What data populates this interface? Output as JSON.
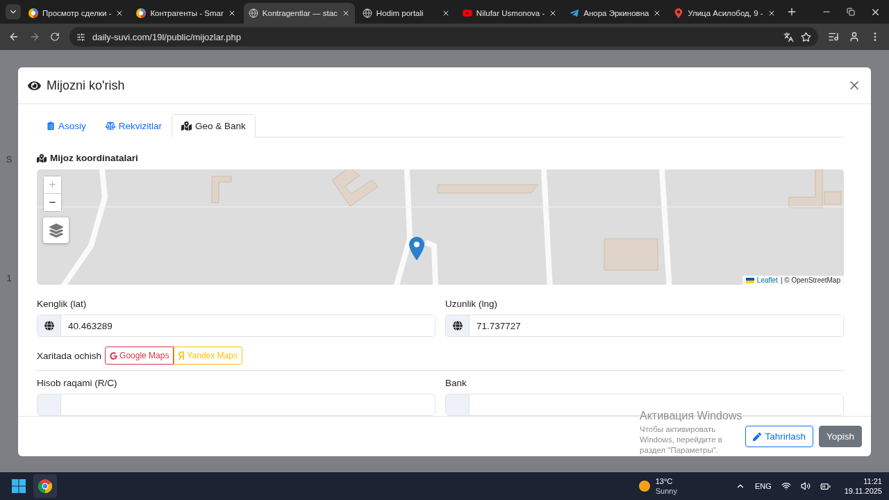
{
  "browser": {
    "tabs": [
      {
        "title": "Просмотр сделки -",
        "kind": "colorwheel",
        "selected": false
      },
      {
        "title": "Контрагенты - Smar",
        "kind": "colorwheel",
        "selected": false
      },
      {
        "title": "Kontragentlar — stac",
        "kind": "globe",
        "selected": true
      },
      {
        "title": "Hodim portali",
        "kind": "globe",
        "selected": false
      },
      {
        "title": "Nilufar Usmonova -",
        "kind": "youtube",
        "selected": false
      },
      {
        "title": "Анора Эркиновна",
        "kind": "telegram",
        "selected": false
      },
      {
        "title": "Улица Асилобод, 9 -",
        "kind": "pin",
        "selected": false
      }
    ],
    "address": "daily-suvi.com/19l/public/mijozlar.php"
  },
  "background_page": {
    "letters": [
      "S",
      "1"
    ]
  },
  "modal": {
    "title": "Mijozni ko'rish",
    "tabs": [
      {
        "label": "Asosiy",
        "selected": false
      },
      {
        "label": "Rekvizitlar",
        "selected": false
      },
      {
        "label": "Geo & Bank",
        "selected": true
      }
    ],
    "section_title": "Mijoz koordinatalari",
    "map": {
      "zoom_in": "+",
      "zoom_out": "−",
      "attribution_link": "Leaflet",
      "attribution_text": "| © OpenStreetMap"
    },
    "coordinates": [
      {
        "label": "Kenglik (lat)",
        "value": "40.463289"
      },
      {
        "label": "Uzunlik (lng)",
        "value": "71.737727"
      }
    ],
    "open_in": {
      "label": "Xaritada ochish",
      "links": [
        {
          "label": "Google Maps",
          "kind": "google"
        },
        {
          "label": "Yandex Maps",
          "kind": "yandex"
        }
      ]
    },
    "bank_fields": [
      {
        "label": "Hisob raqami (R/C)"
      },
      {
        "label": "Bank"
      }
    ],
    "buttons": [
      {
        "label": "Tahrirlash",
        "kind": "outline"
      },
      {
        "label": "Yopish",
        "kind": "secondary"
      }
    ]
  },
  "activation": {
    "title": "Активация Windows",
    "text": "Чтобы активировать Windows, перейдите в раздел \"Параметры\"."
  },
  "taskbar": {
    "temperature": "13°C",
    "weather": "Sunny",
    "language": "ENG",
    "time": "11:21",
    "date": "19.11.2025"
  }
}
